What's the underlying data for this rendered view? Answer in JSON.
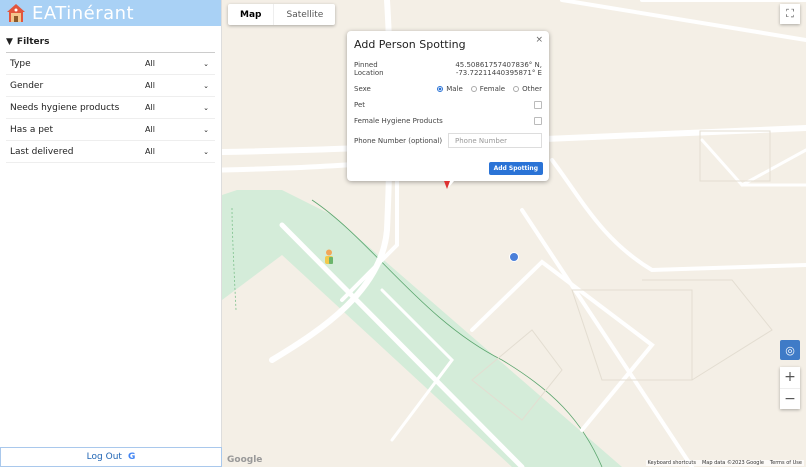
{
  "brand": {
    "title": "EATinérant",
    "logo_icon": "house-icon"
  },
  "filters": {
    "header": "Filters",
    "items": [
      {
        "label": "Type",
        "value": "All"
      },
      {
        "label": "Gender",
        "value": "All"
      },
      {
        "label": "Needs hygiene products",
        "value": "All"
      },
      {
        "label": "Has a pet",
        "value": "All"
      },
      {
        "label": "Last delivered",
        "value": "All"
      }
    ]
  },
  "logout": {
    "label": "Log Out",
    "icon_text": "G"
  },
  "map": {
    "types": [
      "Map",
      "Satellite"
    ],
    "selected_type": "Map",
    "google_label": "Google",
    "attribution": [
      "Keyboard shortcuts",
      "Map data ©2023 Google",
      "Terms of Use"
    ]
  },
  "popup": {
    "title": "Add Person Spotting",
    "close": "×",
    "location_label": "Pinned Location",
    "latitude": "45.50861757407836° N,",
    "longitude": "-73.72211440395871° E",
    "sexe_label": "Sexe",
    "sexe_options": [
      "Male",
      "Female",
      "Other"
    ],
    "sexe_selected": "Male",
    "pet_label": "Pet",
    "hygiene_label": "Female Hygiene Products",
    "phone_label": "Phone Number (optional)",
    "phone_placeholder": "Phone Number",
    "submit_label": "Add Spotting"
  },
  "colors": {
    "brand_bar": "#a9d1f5",
    "primary": "#2a73d6",
    "map_bg": "#f4efe6",
    "park": "#d4ecd9"
  }
}
